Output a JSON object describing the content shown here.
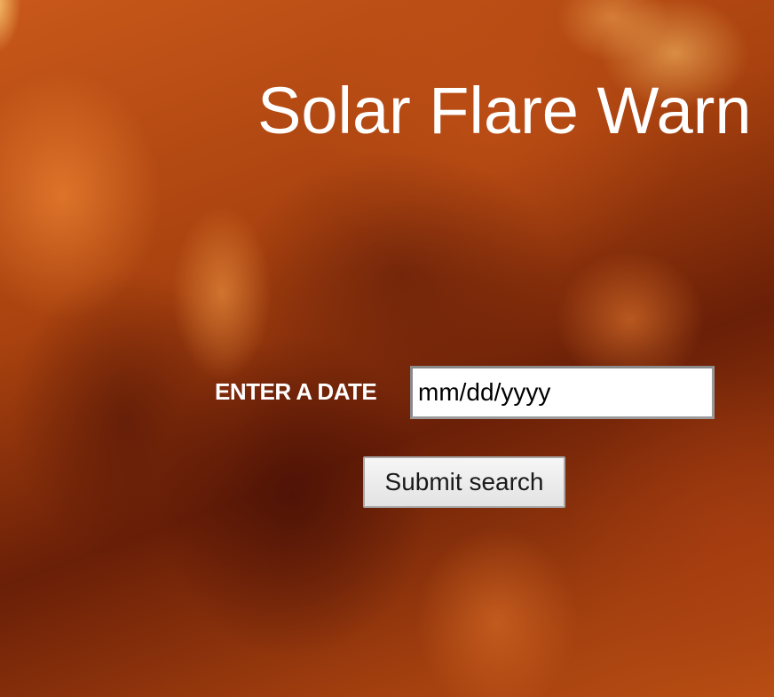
{
  "page": {
    "title": "Solar Flare Warn"
  },
  "search_form": {
    "date_label": "ENTER A DATE",
    "date_placeholder": "mm/dd/yyyy",
    "date_value": "",
    "submit_label": "Submit search"
  },
  "colors": {
    "title_text": "#ffffff",
    "label_text": "#ffffff",
    "background_accent": "#a8400c"
  }
}
